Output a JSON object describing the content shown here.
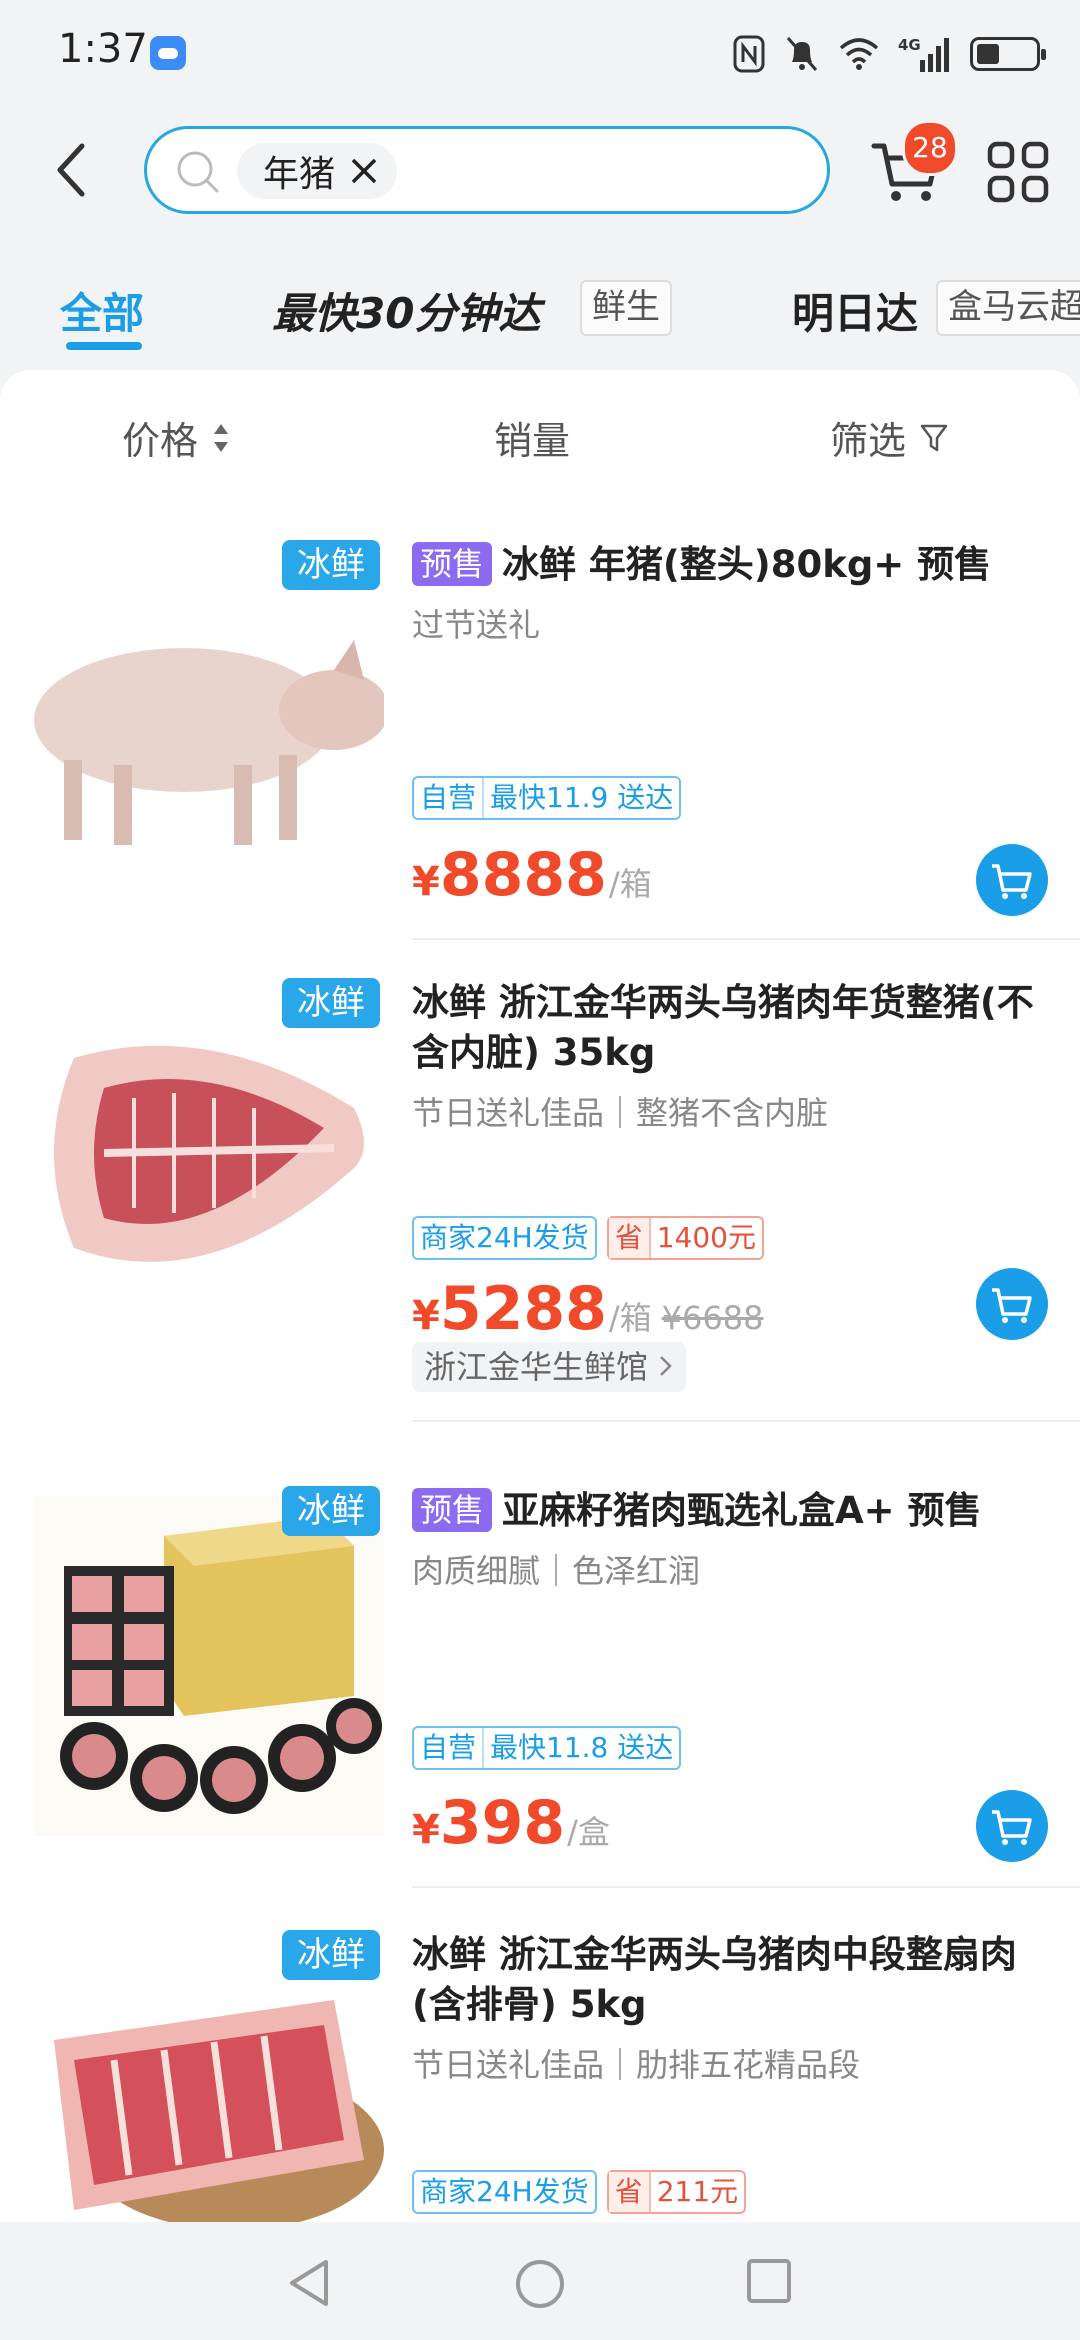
{
  "status": {
    "time": "1:37",
    "network": "4G"
  },
  "search": {
    "chip_text": "年猪",
    "cart_count": "28"
  },
  "tabs": [
    {
      "label": "全部"
    },
    {
      "label": "最快30分钟达",
      "tag": "鲜生"
    },
    {
      "label": "明日达",
      "tag": "盒马云超"
    }
  ],
  "sort": {
    "price": "价格",
    "sales": "销量",
    "filter": "筛选"
  },
  "products": [
    {
      "fresh": "冰鲜",
      "presale": "预售",
      "title": "冰鲜 年猪(整头)80kg+  预售",
      "sub": "过节送礼",
      "badge_a_l": "自营",
      "badge_a_r": "最快11.9 送达",
      "currency": "¥",
      "price": "8888",
      "unit": "/箱"
    },
    {
      "fresh": "冰鲜",
      "title": "冰鲜 浙江金华两头乌猪肉年货整猪(不含内脏) 35kg",
      "sub": "节日送礼佳品｜整猪不含内脏",
      "badge_a": "商家24H发货",
      "badge_b_l": "省",
      "badge_b_r": "1400元",
      "currency": "¥",
      "price": "5288",
      "unit": "/箱",
      "orig": "¥6688",
      "shop": "浙江金华生鲜馆"
    },
    {
      "fresh": "冰鲜",
      "presale": "预售",
      "title": "亚麻籽猪肉甄选礼盒A+ 预售",
      "sub": "肉质细腻｜色泽红润",
      "badge_a_l": "自营",
      "badge_a_r": "最快11.8 送达",
      "currency": "¥",
      "price": "398",
      "unit": "/盒"
    },
    {
      "fresh": "冰鲜",
      "title": "冰鲜 浙江金华两头乌猪肉中段整扇肉(含排骨) 5kg",
      "sub": "节日送礼佳品｜肋排五花精品段",
      "badge_a": "商家24H发货",
      "badge_b_l": "省",
      "badge_b_r": "211元"
    }
  ]
}
